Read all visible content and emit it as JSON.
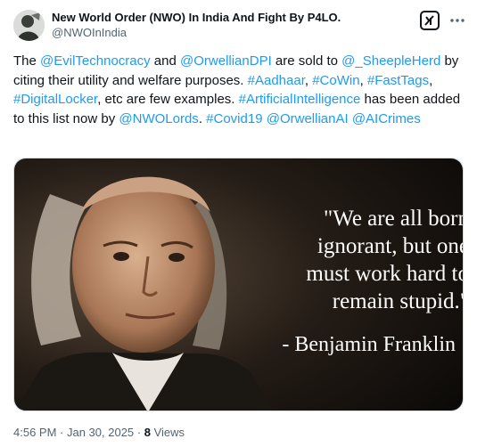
{
  "author": {
    "display_name": "New World Order (NWO) In India And Fight By P4LO.",
    "handle": "@NWOInIndia"
  },
  "tweet": {
    "segments": [
      {
        "text": "The ",
        "type": "text"
      },
      {
        "text": "@EvilTechnocracy",
        "type": "mention"
      },
      {
        "text": " and ",
        "type": "text"
      },
      {
        "text": "@OrwellianDPI",
        "type": "mention"
      },
      {
        "text": " are sold to ",
        "type": "text"
      },
      {
        "text": "@_SheepleHerd",
        "type": "mention"
      },
      {
        "text": " by citing their utility and welfare purposes. ",
        "type": "text"
      },
      {
        "text": "#Aadhaar",
        "type": "hashtag"
      },
      {
        "text": ", ",
        "type": "text"
      },
      {
        "text": "#CoWin",
        "type": "hashtag"
      },
      {
        "text": ", ",
        "type": "text"
      },
      {
        "text": "#FastTags",
        "type": "hashtag"
      },
      {
        "text": ", ",
        "type": "text"
      },
      {
        "text": "#DigitalLocker",
        "type": "hashtag"
      },
      {
        "text": ", etc are few examples. ",
        "type": "text"
      },
      {
        "text": "#ArtificialIntelligence",
        "type": "hashtag"
      },
      {
        "text": " has been added to this list now by ",
        "type": "text"
      },
      {
        "text": "@NWOLords",
        "type": "mention"
      },
      {
        "text": ". ",
        "type": "text"
      },
      {
        "text": "#Covid19",
        "type": "hashtag"
      },
      {
        "text": " ",
        "type": "text"
      },
      {
        "text": "@OrwellianAI",
        "type": "mention"
      },
      {
        "text": " ",
        "type": "text"
      },
      {
        "text": "@AICrimes",
        "type": "mention"
      }
    ]
  },
  "media": {
    "quote_lines": [
      "\"We are all born",
      "ignorant, but one",
      "must work hard to",
      "remain stupid.\""
    ],
    "attribution": "- Benjamin Franklin"
  },
  "meta": {
    "time": "4:56 PM",
    "separator": " · ",
    "date": "Jan 30, 2025",
    "views_count": "8",
    "views_label": " Views"
  },
  "colors": {
    "link": "#1d9bf0",
    "text": "#0f1419",
    "secondary": "#536471"
  },
  "icons": {
    "grok": "grok-icon",
    "more": "more-icon"
  }
}
